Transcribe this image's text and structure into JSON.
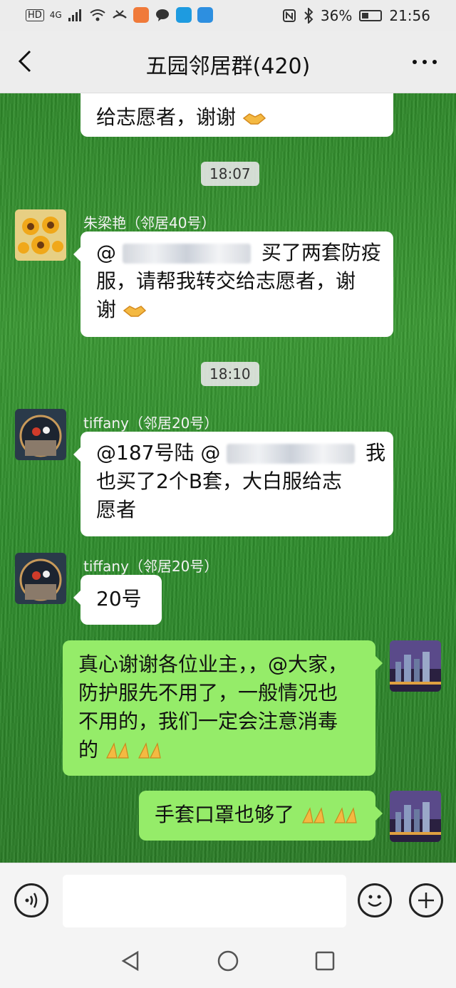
{
  "status_bar": {
    "network_label": "HD",
    "signal_label": "4G",
    "battery_text": "36%",
    "battery_level": 0.36,
    "time": "21:56"
  },
  "header": {
    "title": "五园邻居群(420)",
    "back_icon": "chevron-left-icon",
    "more_icon": "more-icon"
  },
  "messages": [
    {
      "type": "partial_text",
      "text": "给志愿者，谢谢",
      "emoji": "handshake-icon"
    },
    {
      "type": "time",
      "text": "18:07"
    },
    {
      "type": "text",
      "sender": "朱梁艳（邻居40号）",
      "avatar": "sunflower-avatar",
      "lines": [
        "@",
        "买了两套防疫",
        "服，请帮我转交给志愿者，谢",
        "谢"
      ],
      "emoji": "handshake-icon"
    },
    {
      "type": "time",
      "text": "18:10"
    },
    {
      "type": "text",
      "sender": "tiffany（邻居20号）",
      "avatar": "window-avatar",
      "lines": [
        "@187号陆 @",
        "我",
        "也买了2个B套，大白服给志",
        "愿者"
      ]
    },
    {
      "type": "text",
      "sender": "tiffany（邻居20号）",
      "avatar": "window-avatar",
      "text": "20号"
    },
    {
      "type": "self",
      "avatar": "city-night-avatar",
      "lines": [
        "真心谢谢各位业主，，@大家，",
        "防护服先不用了，一般情况也",
        "不用的，我们一定会注意消毒",
        "的"
      ],
      "emoji": "pray-icon"
    },
    {
      "type": "self",
      "avatar": "city-night-avatar",
      "text": "手套口罩也够了",
      "emoji": "pray-icon"
    }
  ],
  "input_bar": {
    "placeholder": "",
    "voice_icon": "voice-icon",
    "emoji_icon": "smiley-icon",
    "plus_icon": "plus-icon"
  },
  "nav_bar": {
    "back_icon": "triangle-back-icon",
    "home_icon": "circle-home-icon",
    "recent_icon": "square-recent-icon"
  },
  "colors": {
    "self_bubble": "#95ec69",
    "other_bubble": "#ffffff",
    "chat_bg": "#2f8a2a"
  }
}
